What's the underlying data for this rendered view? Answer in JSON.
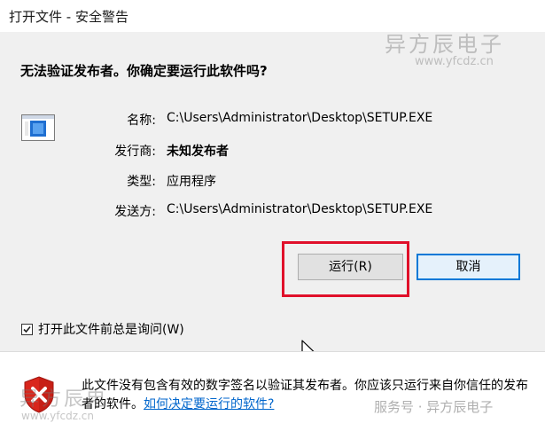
{
  "window": {
    "title": "打开文件 - 安全警告"
  },
  "dialog": {
    "heading": "无法验证发布者。你确定要运行此软件吗?",
    "fields": [
      {
        "label": "名称:",
        "value": "C:\\Users\\Administrator\\Desktop\\SETUP.EXE"
      },
      {
        "label": "发行商:",
        "value": "未知发布者"
      },
      {
        "label": "类型:",
        "value": "应用程序"
      },
      {
        "label": "发送方:",
        "value": "C:\\Users\\Administrator\\Desktop\\SETUP.EXE"
      }
    ],
    "run_button": "运行(R)",
    "cancel_button": "取消",
    "checkbox_label": "打开此文件前总是询问(W)",
    "checkbox_checked": true
  },
  "footer": {
    "text": "此文件没有包含有效的数字签名以验证其发布者。你应该只运行来自你信任的发布者的软件。",
    "link": "如何决定要运行的软件?"
  },
  "watermarks": {
    "brand": "异方辰电子",
    "url": "www.yfcdz.cn",
    "brand_short": "异方辰电",
    "service": "服务号 · 异方辰电子"
  },
  "colors": {
    "highlight": "#e0102a",
    "accent": "#0078d7",
    "link": "#0066cc"
  }
}
